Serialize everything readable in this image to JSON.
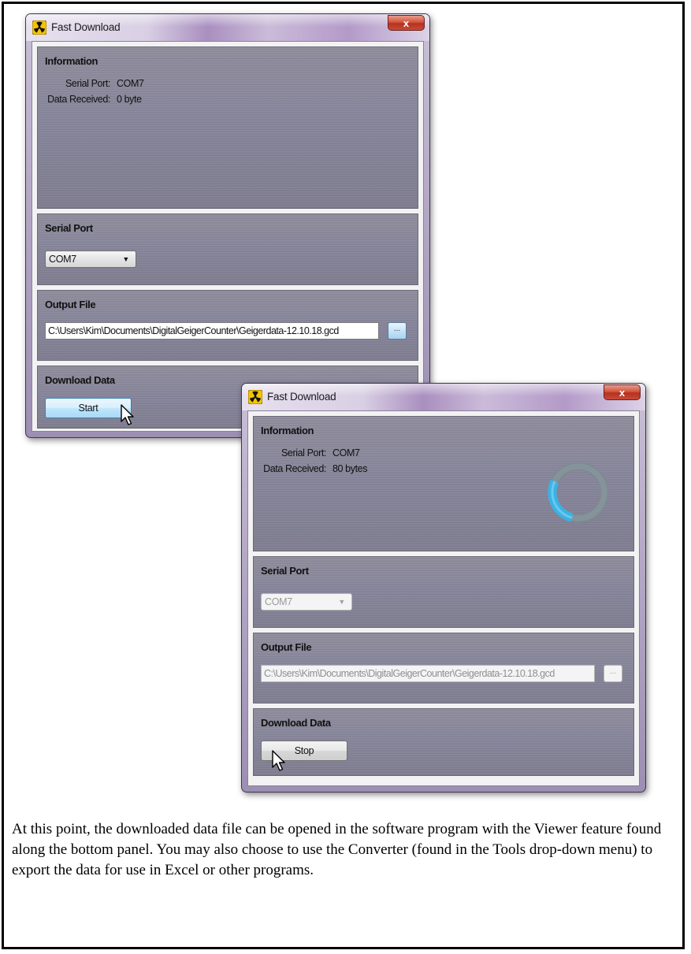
{
  "window_1": {
    "title": "Fast Download",
    "close_label": "x",
    "information": {
      "title": "Information",
      "serial_port_label": "Serial Port:",
      "serial_port_value": "COM7",
      "data_received_label": "Data Received:",
      "data_received_value": "0 byte"
    },
    "serial_port": {
      "title": "Serial Port",
      "selected": "COM7"
    },
    "output_file": {
      "title": "Output File",
      "path": "C:\\Users\\Kim\\Documents\\DigitalGeigerCounter\\Geigerdata-12.10.18.gcd",
      "browse_label": "..."
    },
    "download": {
      "title": "Download Data",
      "button_label": "Start"
    }
  },
  "window_2": {
    "title": "Fast Download",
    "close_label": "x",
    "information": {
      "title": "Information",
      "serial_port_label": "Serial Port:",
      "serial_port_value": "COM7",
      "data_received_label": "Data Received:",
      "data_received_value": "80 bytes"
    },
    "serial_port": {
      "title": "Serial Port",
      "selected": "COM7"
    },
    "output_file": {
      "title": "Output File",
      "path": "C:\\Users\\Kim\\Documents\\DigitalGeigerCounter\\Geigerdata-12.10.18.gcd",
      "browse_label": "..."
    },
    "download": {
      "title": "Download Data",
      "button_label": "Stop"
    }
  },
  "caption": "At this point, the downloaded data file can be opened in the software program with the Viewer feature found along the bottom panel. You may also choose to use the Converter (found in the Tools drop-down menu) to export the data for use in Excel or other programs.",
  "icons": {
    "app": "radiation-icon",
    "close": "close-icon",
    "dropdown": "chevron-down-icon",
    "cursor": "mouse-pointer-icon",
    "spinner": "progress-spinner-icon"
  },
  "colors": {
    "panel": "#86849a",
    "close_button": "#c94b35",
    "hover_button": "#bee6fd",
    "spinner_track": "#7c8a92",
    "spinner_active": "#39b3e6"
  }
}
